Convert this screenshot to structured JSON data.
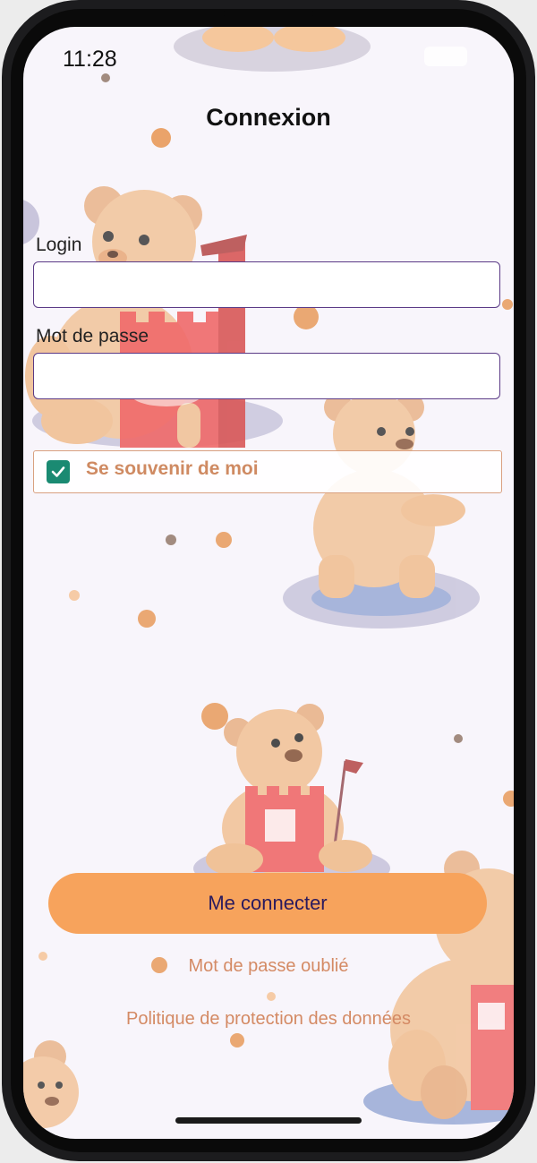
{
  "status_bar": {
    "time": "11:28"
  },
  "screen": {
    "title": "Connexion"
  },
  "login_form": {
    "login_label": "Login",
    "login_value": "",
    "password_label": "Mot de passe",
    "password_value": "",
    "remember_label": "Se souvenir de moi",
    "remember_checked": true
  },
  "actions": {
    "connect_label": "Me connecter",
    "forgot_password_label": "Mot de passe oublié",
    "privacy_policy_label": "Politique de protection des données"
  },
  "colors": {
    "accent_orange": "#f7a35c",
    "link_color": "#d48a64",
    "checkbox_green": "#1a8a72",
    "input_border": "#5a3a86",
    "background": "#f8f5fb"
  },
  "icons": [
    "check-icon",
    "teddy-bear-illustration",
    "castle-illustration"
  ]
}
